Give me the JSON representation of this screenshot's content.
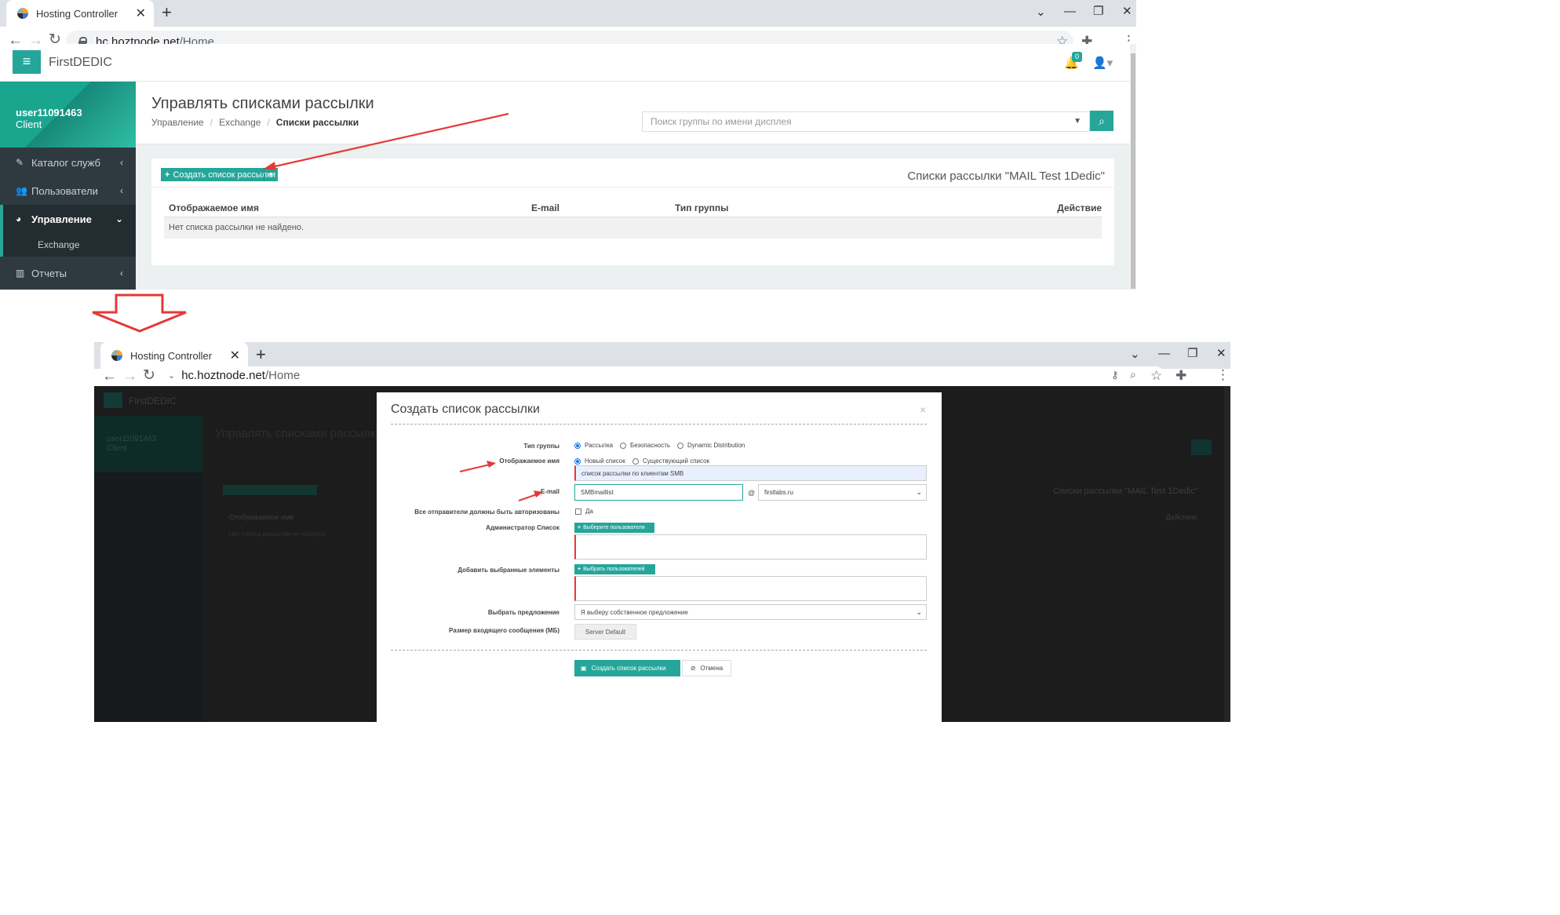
{
  "browser_top": {
    "tab_title": "Hosting Controller",
    "url_host": "hc.hoztnode.net",
    "url_path": "/Home"
  },
  "browser_bottom": {
    "tab_title": "Hosting Controller",
    "url_host": "hc.hoztnode.net",
    "url_path": "/Home"
  },
  "app": {
    "brand": "FirstDEDIC",
    "notification_count": "0",
    "user_name": "user11091463",
    "user_role": "Client"
  },
  "sidebar": {
    "items": [
      {
        "label": "Каталог служб",
        "icon": "wrench-icon"
      },
      {
        "label": "Пользователи",
        "icon": "users-icon"
      },
      {
        "label": "Управление",
        "icon": "cog-icon"
      },
      {
        "label": "Отчеты",
        "icon": "bar-chart-icon"
      }
    ],
    "sub_item": "Exchange"
  },
  "page": {
    "title": "Управлять списками рассылки",
    "breadcrumb": [
      "Управление",
      "Exchange",
      "Списки рассылки"
    ],
    "search_placeholder": "Поиск группы по имени дисплея",
    "create_button": "Создать список рассылки",
    "panel_title": "Списки рассылки \"MAIL Test 1Dedic\"",
    "columns": [
      "Отображаемое имя",
      "E-mail",
      "Тип группы",
      "Действие"
    ],
    "empty_message": "Нет списка рассылки не найдено."
  },
  "modal": {
    "title": "Создать список рассылки",
    "group_type_label": "Тип группы",
    "group_type_options": [
      "Рассылка",
      "Безопасность",
      "Dynamic Distribution"
    ],
    "display_name_label": "Отображаемое имя",
    "display_name_options": [
      "Новый список",
      "Существующий список"
    ],
    "display_name_value": "список рассылки по клиентам SMB",
    "email_label": "E-mail",
    "email_value": "SMBmaillist",
    "at_sign": "@",
    "domain_value": "firstlabs.ru",
    "auth_label": "Все отправители должны быть авторизованы",
    "auth_option": "Да",
    "admin_label": "Администратор Список",
    "admin_button": "Выберите пользователя",
    "members_label": "Добавить выбранные элементы",
    "members_button": "Выбрать пользователей",
    "offer_label": "Выбрать предложение",
    "offer_value": "Я выберу собственное предложение",
    "size_label": "Размер входящего сообщения (МБ)",
    "size_value": "Server Default",
    "submit_button": "Создать список рассылки",
    "cancel_button": "Отмена"
  },
  "background_dimmed": {
    "title": "Управлять списками рассылки",
    "brand": "FirstDEDIC",
    "user_name": "user11091463",
    "user_role": "Client",
    "panel_title": "Списки рассылки \"MAIL Test 1Dedic\"",
    "action_col": "Действие",
    "col_name": "Отображаемое имя",
    "empty": "Нет списка рассылки не найдено."
  },
  "colors": {
    "accent": "#26a69a",
    "sidebar": "#2f3a40",
    "annotation": "#e53935"
  }
}
